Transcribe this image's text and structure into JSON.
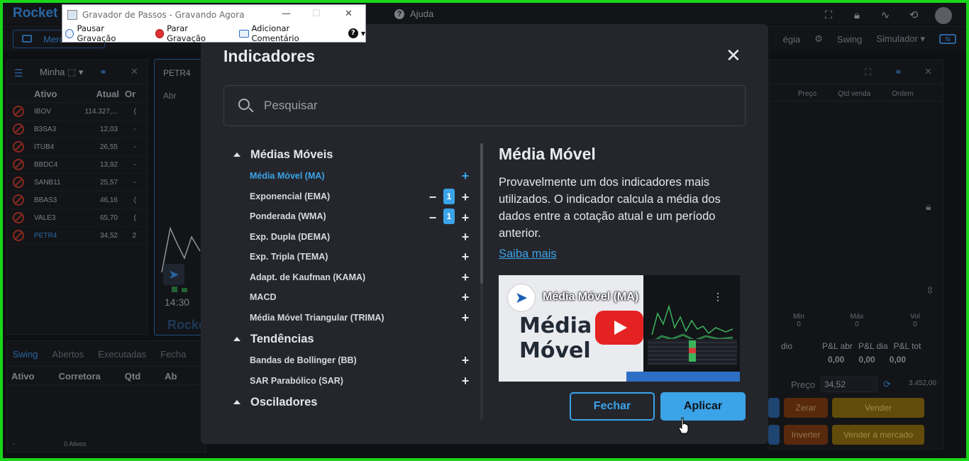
{
  "app": {
    "logo": "Rocket",
    "help": "Ajuda"
  },
  "subbar": {
    "mercado_tab": "Merc",
    "estrategia": "égia",
    "swing": "Swing",
    "simulador": "Simulador ▾"
  },
  "watchlist": {
    "title": "Minha ⬚ ▾",
    "columns": [
      "Ativo",
      "Atual",
      "Or"
    ],
    "rows": [
      {
        "ticker": "IBOV",
        "price": "114.327,...",
        "change": "("
      },
      {
        "ticker": "B3SA3",
        "price": "12,03",
        "change": "-"
      },
      {
        "ticker": "ITUB4",
        "price": "26,55",
        "change": "-"
      },
      {
        "ticker": "BBDC4",
        "price": "13,92",
        "change": "-"
      },
      {
        "ticker": "SANB11",
        "price": "25,57",
        "change": "-"
      },
      {
        "ticker": "BBAS3",
        "price": "46,16",
        "change": "("
      },
      {
        "ticker": "VALE3",
        "price": "65,70",
        "change": "("
      },
      {
        "ticker": "PETR4",
        "price": "34,52",
        "change": "2"
      }
    ]
  },
  "chart_panel": {
    "ticker": "PETR4",
    "abr": "Abr",
    "time": "14:30",
    "brand": "Rocke"
  },
  "bottom_panel": {
    "tabs": [
      "Swing",
      "Abertos",
      "Executadas",
      "Fecha"
    ],
    "columns": [
      "Ativo",
      "Corretora",
      "Qtd",
      "Ab"
    ],
    "footer_dash": "-",
    "footer": "0 Ativos"
  },
  "right_panel": {
    "columns": [
      "Preço",
      "Qtd venda",
      "Ordem"
    ],
    "stats": [
      {
        "label": "Min",
        "value": "0"
      },
      {
        "label": "Máx",
        "value": "0"
      },
      {
        "label": "Vol",
        "value": "0"
      }
    ],
    "pl_labels": [
      "dio",
      "P&L abr",
      "P&L dia",
      "P&L tot"
    ],
    "pl_values": [
      "0,00",
      "0,00",
      "0,00"
    ],
    "preco_label": "Preço",
    "preco_value": "34,52",
    "total": "3.452,00",
    "buttons": {
      "zerar": "Zerar",
      "vender": "Vender",
      "inverter": "Inverter",
      "vender_mercado": "Vender a mercado"
    }
  },
  "recorder": {
    "title": "Gravador de Passos - Gravando Agora",
    "pause": "Pausar Gravação",
    "stop": "Parar Gravação",
    "comment": "Adicionar Comentário"
  },
  "modal": {
    "title": "Indicadores",
    "search_placeholder": "Pesquisar",
    "categories": [
      {
        "name": "Médias Móveis",
        "items": [
          {
            "label": "Média Móvel (MA)",
            "active": true,
            "count": ""
          },
          {
            "label": "Exponencial (EMA)",
            "count": "1"
          },
          {
            "label": "Ponderada (WMA)",
            "count": "1"
          },
          {
            "label": "Exp. Dupla (DEMA)",
            "count": ""
          },
          {
            "label": "Exp. Tripla (TEMA)",
            "count": ""
          },
          {
            "label": "Adapt. de Kaufman (KAMA)",
            "count": ""
          },
          {
            "label": "MACD",
            "count": ""
          },
          {
            "label": "Média Móvel Triangular (TRIMA)",
            "count": ""
          }
        ]
      },
      {
        "name": "Tendências",
        "items": [
          {
            "label": "Bandas de Bollinger (BB)",
            "count": ""
          },
          {
            "label": "SAR Parabólico (SAR)",
            "count": ""
          }
        ]
      },
      {
        "name": "Osciladores",
        "items": []
      }
    ],
    "detail": {
      "title": "Média Móvel",
      "description": "Provavelmente um dos indicadores mais utilizados. O indicador calcula a média dos dados entre a cotação atual e um período anterior.",
      "link": "Saiba mais",
      "video_title": "Média Móvel (MA)",
      "video_text_1": "Média",
      "video_text_2": "Móvel"
    },
    "btn_close": "Fechar",
    "btn_apply": "Aplicar"
  }
}
